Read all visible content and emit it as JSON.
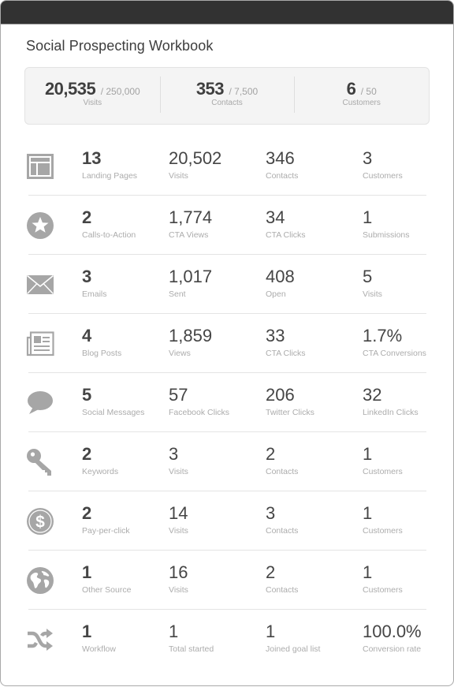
{
  "window": {
    "title": "Social Prospecting Workbook"
  },
  "colors": {
    "titlebar": "#323232",
    "icon": "#a6a6a6",
    "value_text": "#454545",
    "label_text": "#acacac",
    "summary_bg": "#f4f4f4"
  },
  "summary": [
    {
      "value": "20,535",
      "goal": "/ 250,000",
      "label": "Visits"
    },
    {
      "value": "353",
      "goal": "/ 7,500",
      "label": "Contacts"
    },
    {
      "value": "6",
      "goal": "/ 50",
      "label": "Customers"
    }
  ],
  "rows": [
    {
      "icon": "landing-page-icon",
      "cells": [
        {
          "value": "13",
          "label": "Landing Pages"
        },
        {
          "value": "20,502",
          "label": "Visits"
        },
        {
          "value": "346",
          "label": "Contacts"
        },
        {
          "value": "3",
          "label": "Customers"
        }
      ]
    },
    {
      "icon": "star-icon",
      "cells": [
        {
          "value": "2",
          "label": "Calls-to-Action"
        },
        {
          "value": "1,774",
          "label": "CTA Views"
        },
        {
          "value": "34",
          "label": "CTA Clicks"
        },
        {
          "value": "1",
          "label": "Submissions"
        }
      ]
    },
    {
      "icon": "envelope-icon",
      "cells": [
        {
          "value": "3",
          "label": "Emails"
        },
        {
          "value": "1,017",
          "label": "Sent"
        },
        {
          "value": "408",
          "label": "Open"
        },
        {
          "value": "5",
          "label": "Visits"
        }
      ]
    },
    {
      "icon": "newspaper-icon",
      "cells": [
        {
          "value": "4",
          "label": "Blog Posts"
        },
        {
          "value": "1,859",
          "label": "Views"
        },
        {
          "value": "33",
          "label": "CTA Clicks"
        },
        {
          "value": "1.7%",
          "label": "CTA Conversions"
        }
      ]
    },
    {
      "icon": "speech-bubble-icon",
      "cells": [
        {
          "value": "5",
          "label": "Social Messages"
        },
        {
          "value": "57",
          "label": "Facebook Clicks"
        },
        {
          "value": "206",
          "label": "Twitter Clicks"
        },
        {
          "value": "32",
          "label": "LinkedIn Clicks"
        }
      ]
    },
    {
      "icon": "key-icon",
      "cells": [
        {
          "value": "2",
          "label": "Keywords"
        },
        {
          "value": "3",
          "label": "Visits"
        },
        {
          "value": "2",
          "label": "Contacts"
        },
        {
          "value": "1",
          "label": "Customers"
        }
      ]
    },
    {
      "icon": "dollar-coin-icon",
      "cells": [
        {
          "value": "2",
          "label": "Pay-per-click"
        },
        {
          "value": "14",
          "label": "Visits"
        },
        {
          "value": "3",
          "label": "Contacts"
        },
        {
          "value": "1",
          "label": "Customers"
        }
      ]
    },
    {
      "icon": "globe-icon",
      "cells": [
        {
          "value": "1",
          "label": "Other Source"
        },
        {
          "value": "16",
          "label": "Visits"
        },
        {
          "value": "2",
          "label": "Contacts"
        },
        {
          "value": "1",
          "label": "Customers"
        }
      ]
    },
    {
      "icon": "shuffle-icon",
      "cells": [
        {
          "value": "1",
          "label": "Workflow"
        },
        {
          "value": "1",
          "label": "Total started"
        },
        {
          "value": "1",
          "label": "Joined goal list"
        },
        {
          "value": "100.0%",
          "label": "Conversion rate"
        }
      ]
    }
  ]
}
